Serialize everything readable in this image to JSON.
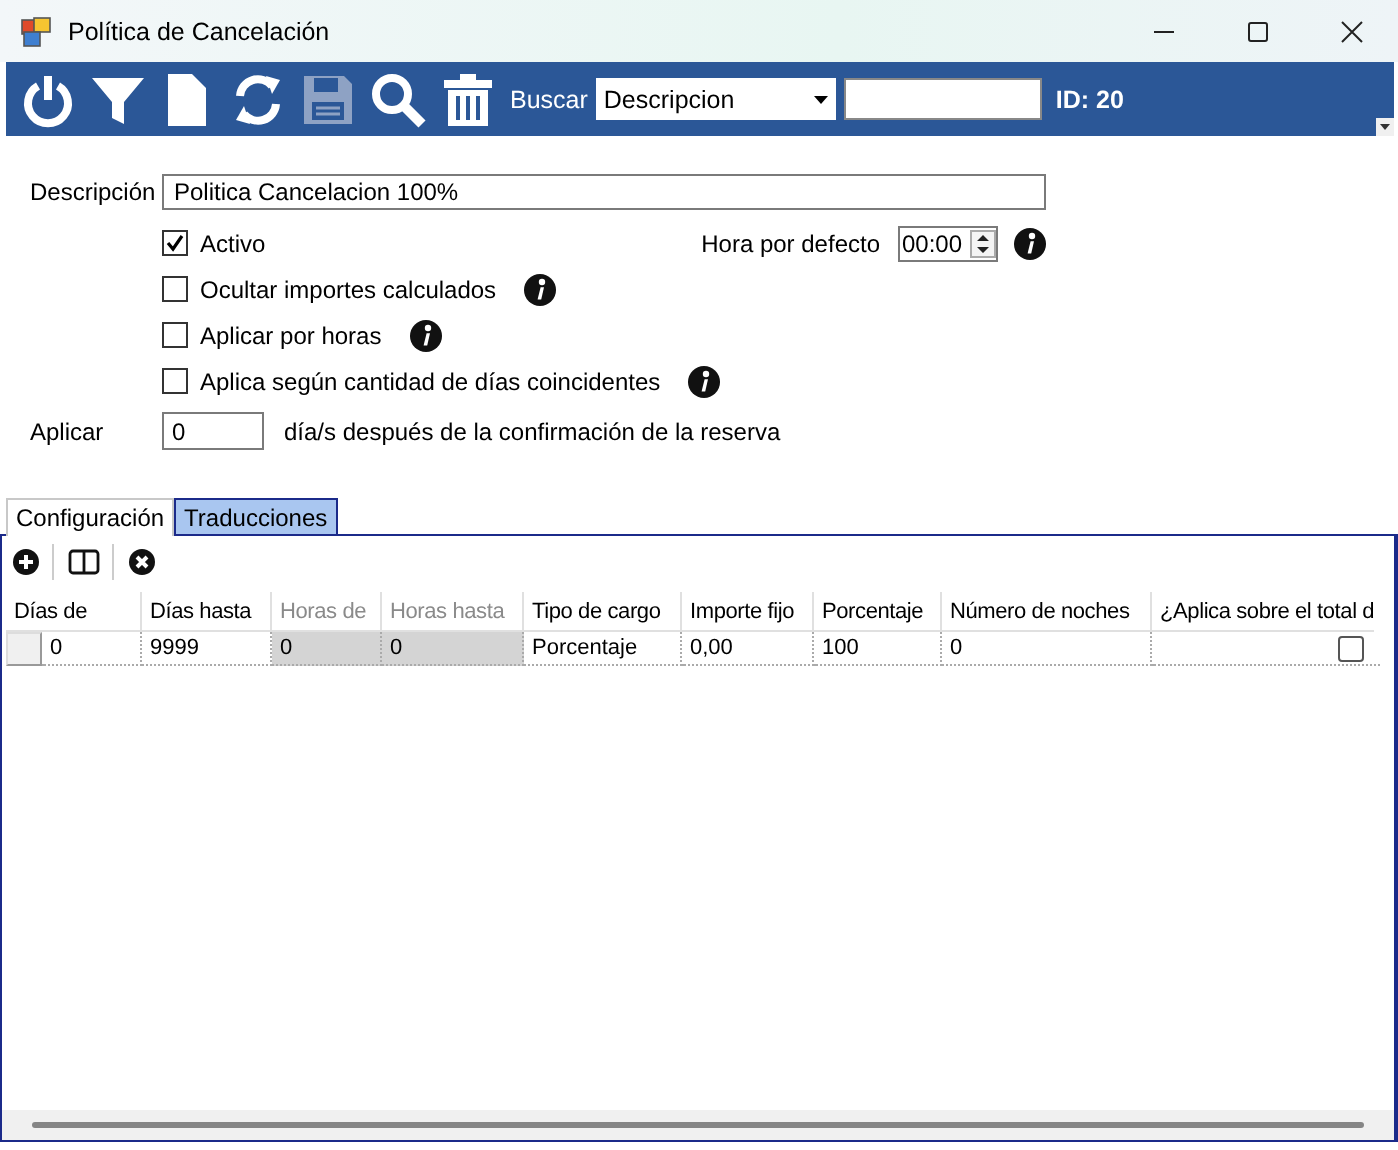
{
  "window": {
    "title": "Política de Cancelación"
  },
  "toolbar": {
    "buttons": [
      {
        "kind": "power",
        "disabled": false
      },
      {
        "kind": "filter",
        "disabled": false
      },
      {
        "kind": "new",
        "disabled": false
      },
      {
        "kind": "refresh",
        "disabled": false
      },
      {
        "kind": "save",
        "disabled": true
      },
      {
        "kind": "search",
        "disabled": false
      },
      {
        "kind": "delete",
        "disabled": false
      }
    ],
    "search_label": "Buscar",
    "search_field": "Descripcion",
    "id_label": "ID: 20"
  },
  "form": {
    "description_label": "Descripción",
    "description": "Politica Cancelacion 100%",
    "checkboxes": [
      {
        "label": "Activo",
        "checked": true,
        "info": false
      },
      {
        "label": "Ocultar importes calculados",
        "checked": false,
        "info": true
      },
      {
        "label": "Aplicar por horas",
        "checked": false,
        "info": true
      },
      {
        "label": "Aplica según cantidad de días coincidentes",
        "checked": false,
        "info": true
      }
    ],
    "default_time_label": "Hora por defecto",
    "default_time": "00:00",
    "apply_label": "Aplicar",
    "apply_days": "0",
    "apply_suffix": "día/s después de la confirmación de la reserva"
  },
  "tabs": [
    {
      "label": "Configuración",
      "selected": true
    },
    {
      "label": "Traducciones",
      "selected": false
    }
  ],
  "grid": {
    "tools": [
      {
        "kind": "add"
      },
      {
        "kind": "columns"
      },
      {
        "kind": "remove"
      }
    ],
    "columns": [
      {
        "label": "Días de",
        "disabled": false
      },
      {
        "label": "Días hasta",
        "disabled": false
      },
      {
        "label": "Horas de",
        "disabled": true
      },
      {
        "label": "Horas hasta",
        "disabled": true
      },
      {
        "label": "Tipo de cargo",
        "disabled": false
      },
      {
        "label": "Importe fijo",
        "disabled": false
      },
      {
        "label": "Porcentaje",
        "disabled": false
      },
      {
        "label": "Número de noches",
        "disabled": false
      },
      {
        "label": "¿Aplica sobre el total d",
        "disabled": false
      }
    ],
    "rows": [
      {
        "cells": [
          {
            "kind": "text",
            "value": "0"
          },
          {
            "kind": "text",
            "value": "9999"
          },
          {
            "kind": "text",
            "value": "0"
          },
          {
            "kind": "text",
            "value": "0"
          },
          {
            "kind": "text",
            "value": "Porcentaje"
          },
          {
            "kind": "text",
            "value": "0,00"
          },
          {
            "kind": "text",
            "value": "100"
          },
          {
            "kind": "text",
            "value": "0"
          },
          {
            "kind": "check",
            "checked": false
          }
        ]
      }
    ]
  }
}
